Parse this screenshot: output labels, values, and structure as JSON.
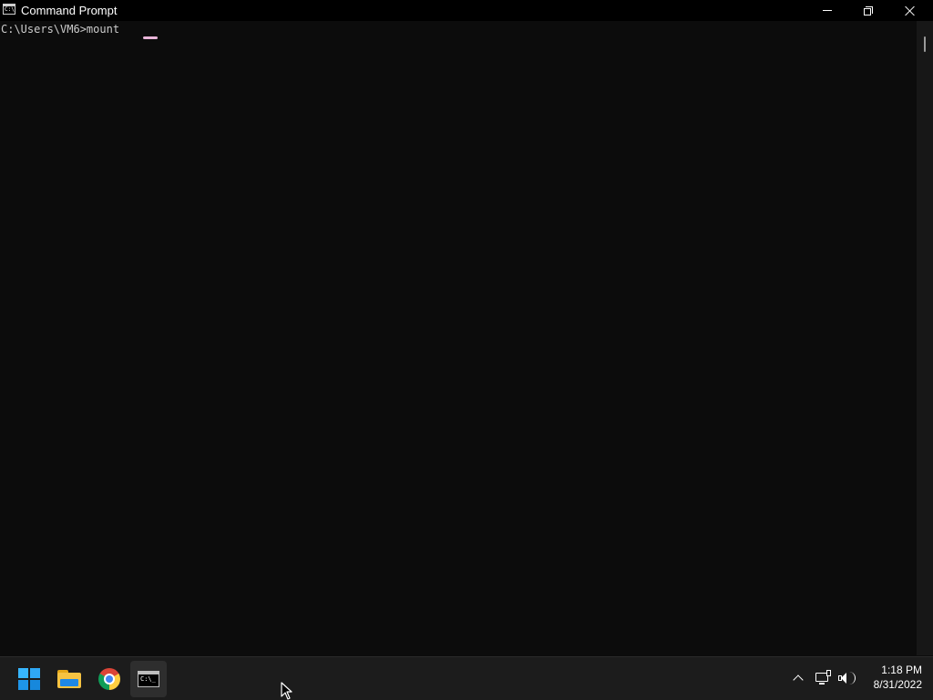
{
  "window": {
    "title": "Command Prompt",
    "icon": "cmd-icon",
    "title_icon_text": "C:\\",
    "controls": {
      "minimize": "minimize-icon",
      "maximize": "restore-icon",
      "close": "close-icon"
    }
  },
  "console": {
    "lines": [
      "C:\\Users\\VM6>mount"
    ],
    "text_color": "#cccccc",
    "background": "#0c0c0c"
  },
  "taskbar": {
    "apps": [
      {
        "name": "Start",
        "icon": "windows-logo-icon"
      },
      {
        "name": "File Explorer",
        "icon": "folder-icon"
      },
      {
        "name": "Google Chrome",
        "icon": "chrome-icon"
      },
      {
        "name": "Command Prompt",
        "icon": "cmd-icon",
        "active": true,
        "icon_text": "C:\\_"
      }
    ],
    "tray": {
      "icons": [
        "chevron-up-icon",
        "network-icon",
        "volume-icon"
      ]
    },
    "clock": {
      "time": "1:18 PM",
      "date": "8/31/2022"
    },
    "active_indicator_color": "#e8b4d8"
  }
}
